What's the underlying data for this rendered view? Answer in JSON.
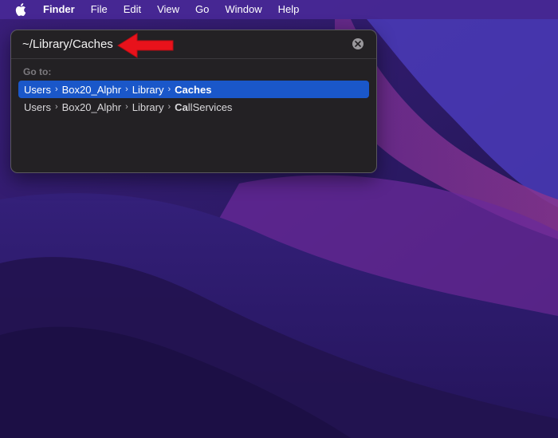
{
  "menubar": {
    "apple_icon": "apple-logo-icon",
    "app_name": "Finder",
    "items": [
      "File",
      "Edit",
      "View",
      "Go",
      "Window",
      "Help"
    ]
  },
  "goto_panel": {
    "path_value": "~/Library/Caches",
    "clear_icon": "clear-circle-x-icon",
    "section_label": "Go to:",
    "results": [
      {
        "segments": [
          "Users",
          "Box20_Alphr",
          "Library"
        ],
        "leaf": "Caches",
        "selected": true
      },
      {
        "segments": [
          "Users",
          "Box20_Alphr",
          "Library"
        ],
        "leaf_match": "Ca",
        "leaf_rest": "llServices",
        "selected": false
      }
    ],
    "separator_glyph": "›"
  },
  "annotation": {
    "arrow_color": "#e8121b",
    "arrow_icon": "red-arrow-pointer-icon"
  },
  "colors": {
    "selection": "#1a57c9",
    "panel_bg": "#232124",
    "menubar_bg": "#4828a0"
  }
}
